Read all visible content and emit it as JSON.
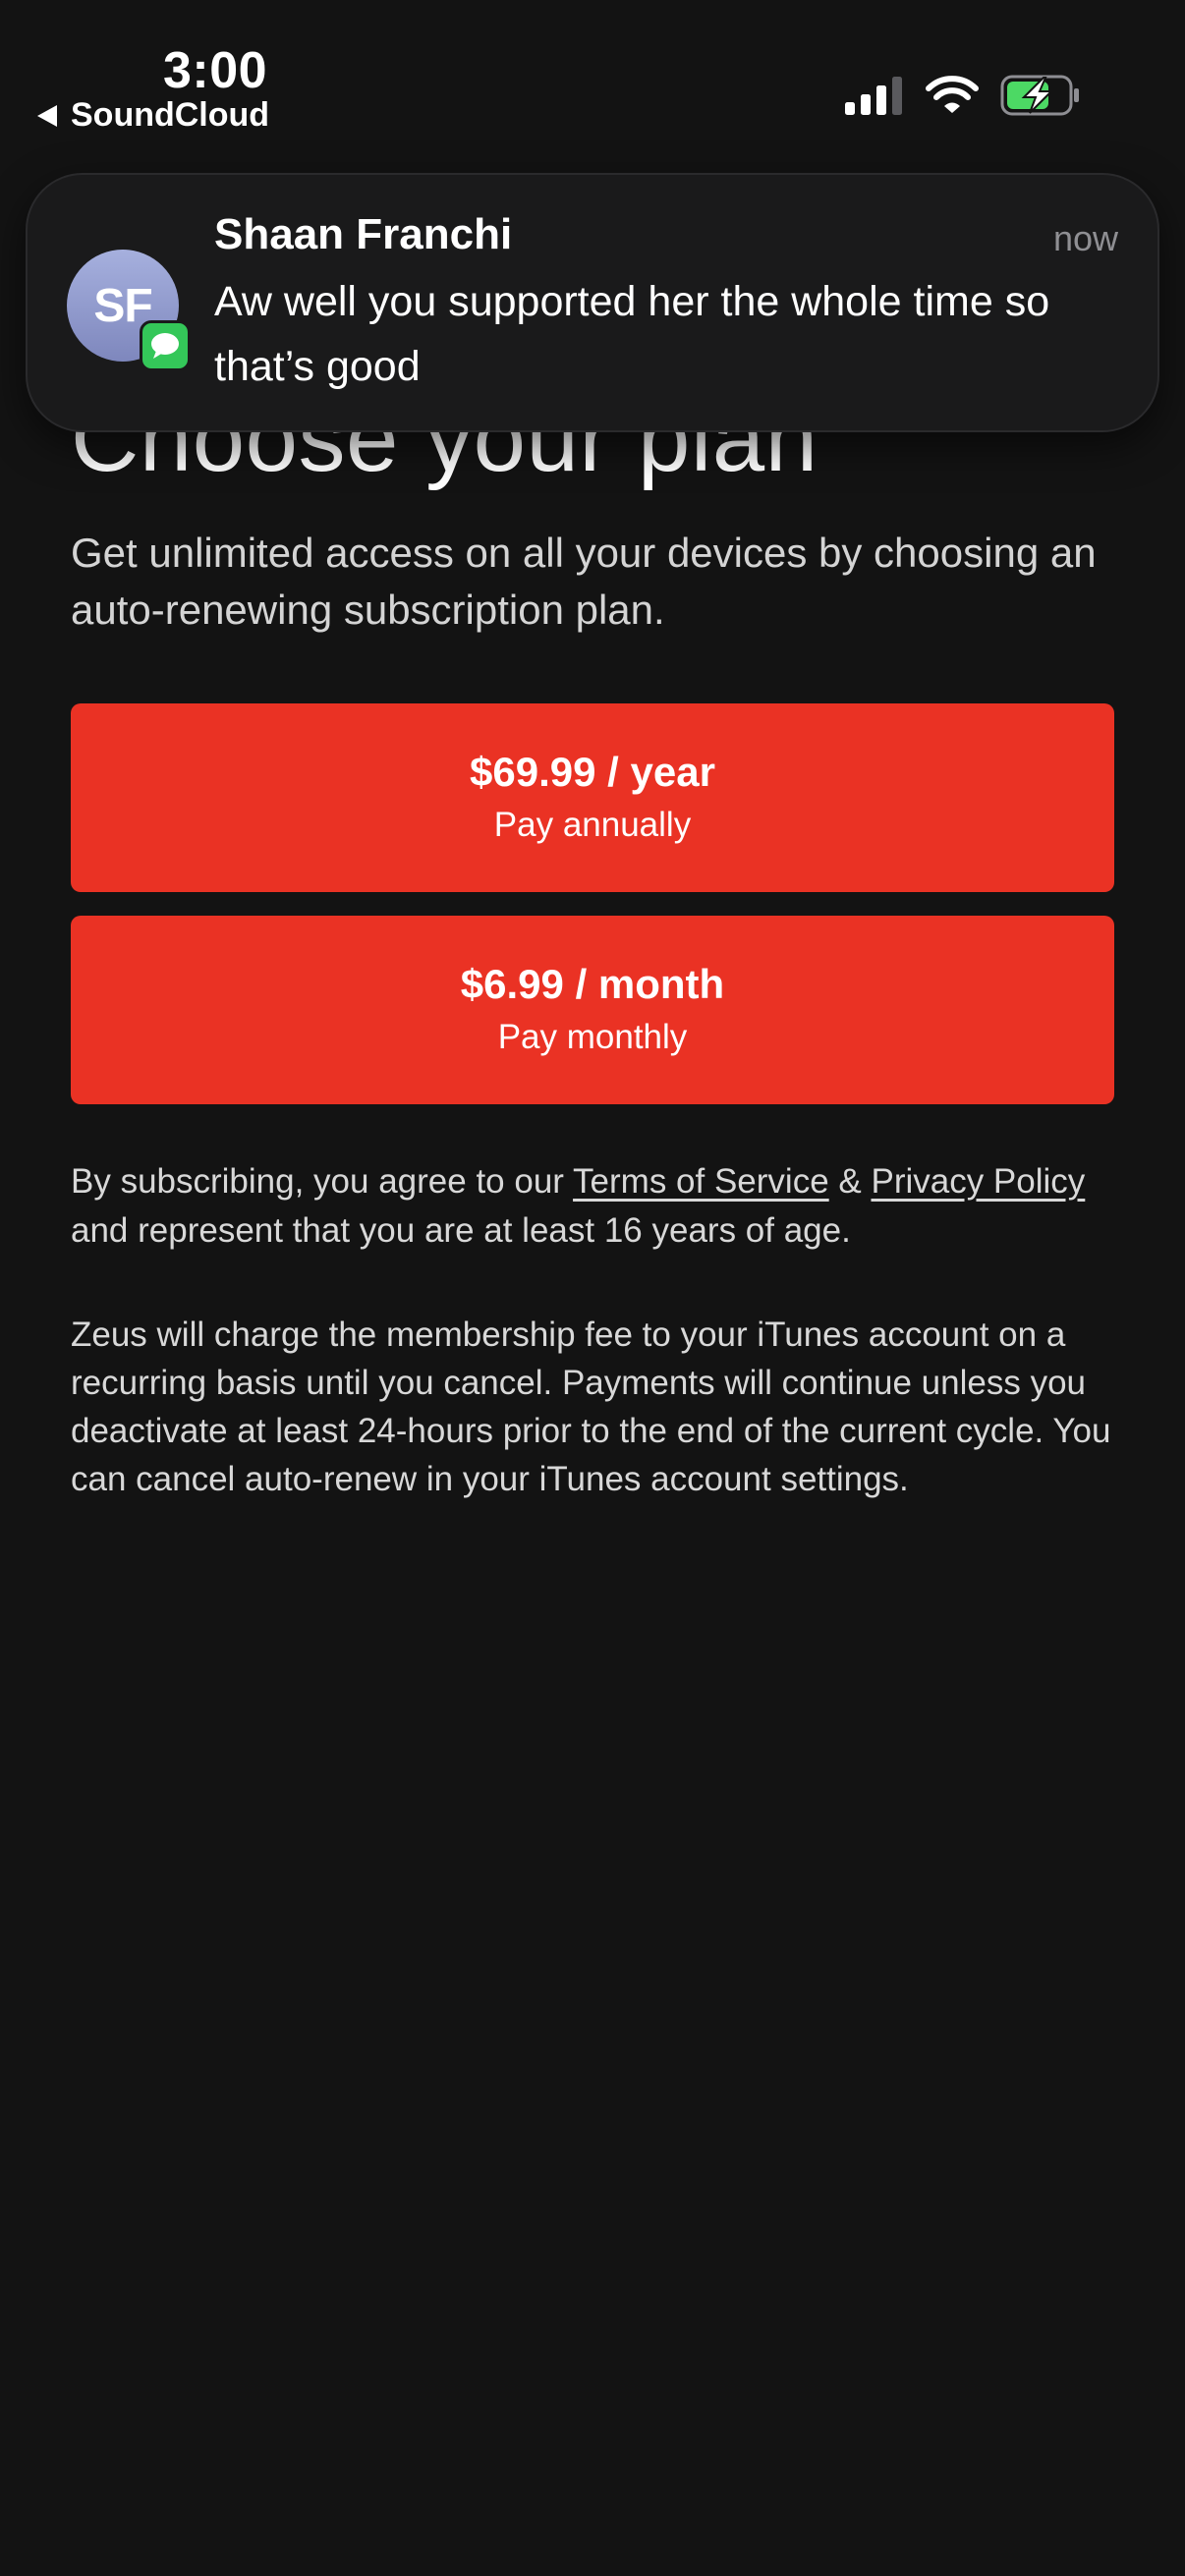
{
  "status_bar": {
    "time": "3:00",
    "back_label": "SoundCloud"
  },
  "notification": {
    "avatar_initials": "SF",
    "sender": "Shaan Franchi",
    "time": "now",
    "message": "Aw well you supported her the whole time so that’s good",
    "app_badge_color": "#34c759"
  },
  "page": {
    "title": "Choose your plan",
    "subtitle": "Get unlimited access on all your devices by choosing an auto-renewing subscription plan."
  },
  "plans": [
    {
      "price": "$69.99 / year",
      "note": "Pay annually"
    },
    {
      "price": "$6.99 / month",
      "note": "Pay monthly"
    }
  ],
  "legal": {
    "prefix": "By subscribing, you agree to our ",
    "terms_label": "Terms of Service",
    "ampersand": " & ",
    "privacy_label": "Privacy Policy",
    "suffix": " and represent that you are at least 16 years of age."
  },
  "billing_text": "Zeus will charge the membership fee to your iTunes account on a recurring basis until you cancel. Payments will continue unless you deactivate at least 24-hours prior to the end of the current cycle. You can cancel auto-renew in your iTunes account settings.",
  "colors": {
    "background": "#131313",
    "accent": "#ea3224",
    "battery_charging": "#4cd964"
  }
}
